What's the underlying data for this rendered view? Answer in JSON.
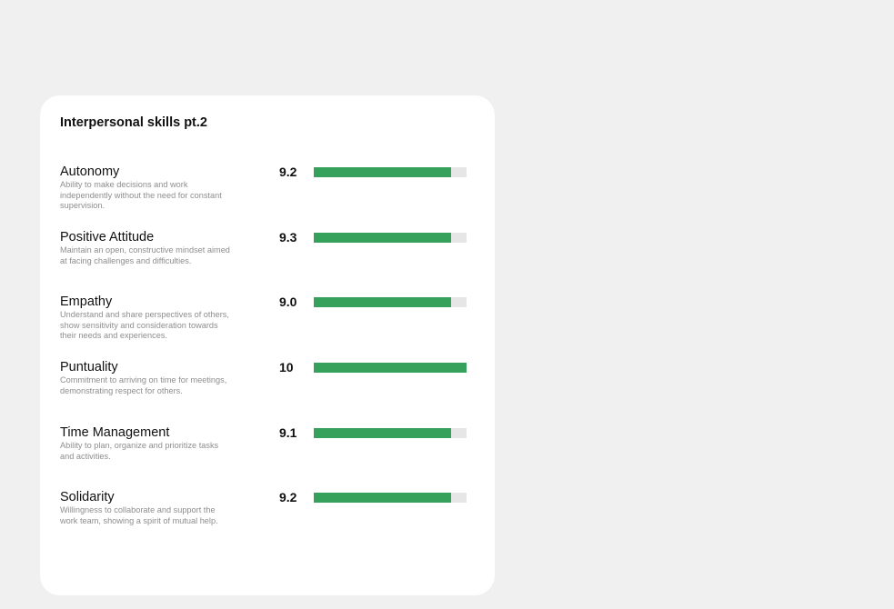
{
  "card": {
    "title": "Interpersonal skills pt.2"
  },
  "colors": {
    "bar_fill": "#36a15a",
    "bar_track": "#e6e6e6",
    "background": "#eff0ef",
    "card": "#ffffff"
  },
  "skills": [
    {
      "name": "Autonomy",
      "description": "Ability to make decisions and work independently without the need for constant supervision.",
      "score": "9.2",
      "level": 0.9
    },
    {
      "name": "Positive Attitude",
      "description": "Maintain an open, constructive mindset aimed at facing challenges and difficulties.",
      "score": "9.3",
      "level": 0.9
    },
    {
      "name": "Empathy",
      "description": "Understand and share perspectives of others, show sensitivity and consideration towards their needs and experiences.",
      "score": "9.0",
      "level": 0.9
    },
    {
      "name": "Puntuality",
      "description": "Commitment to arriving on time for meetings, demonstrating respect for others.",
      "score": "10",
      "level": 1.0
    },
    {
      "name": "Time Management",
      "description": "Ability to plan, organize and prioritize tasks and activities.",
      "score": "9.1",
      "level": 0.9
    },
    {
      "name": "Solidarity",
      "description": "Willingness to collaborate and support the work team, showing a spirit of mutual help.",
      "score": "9.2",
      "level": 0.9
    }
  ]
}
